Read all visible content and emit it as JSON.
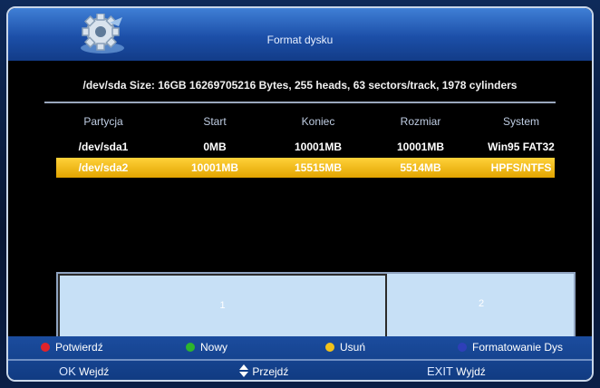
{
  "title": "Format dysku",
  "info": "/dev/sda Size: 16GB 16269705216 Bytes, 255 heads, 63 sectors/track, 1978 cylinders",
  "columns": [
    "Partycja",
    "Start",
    "Koniec",
    "Rozmiar",
    "System"
  ],
  "rows": [
    [
      "/dev/sda1",
      "0MB",
      "10001MB",
      "10001MB",
      "Win95 FAT32"
    ],
    [
      "/dev/sda2",
      "10001MB",
      "15515MB",
      "5514MB",
      "HPFS/NTFS"
    ]
  ],
  "selected_row": 1,
  "partition_bar": {
    "labels": [
      "1",
      "2"
    ],
    "fractions": [
      0.645,
      0.355
    ]
  },
  "color_keys": [
    {
      "color": "#e0232a",
      "label": "Potwierdź"
    },
    {
      "color": "#2db52d",
      "label": "Nowy"
    },
    {
      "color": "#f2c21b",
      "label": "Usuń"
    },
    {
      "color": "#2e3fb8",
      "label": "Formatowanie Dys"
    }
  ],
  "nav": {
    "ok_key": "OK",
    "ok_label": "Wejdź",
    "move_icon": "up-down-arrow-icon",
    "move_label": "Przejdź",
    "exit_key": "EXIT",
    "exit_label": "Wyjdź"
  }
}
